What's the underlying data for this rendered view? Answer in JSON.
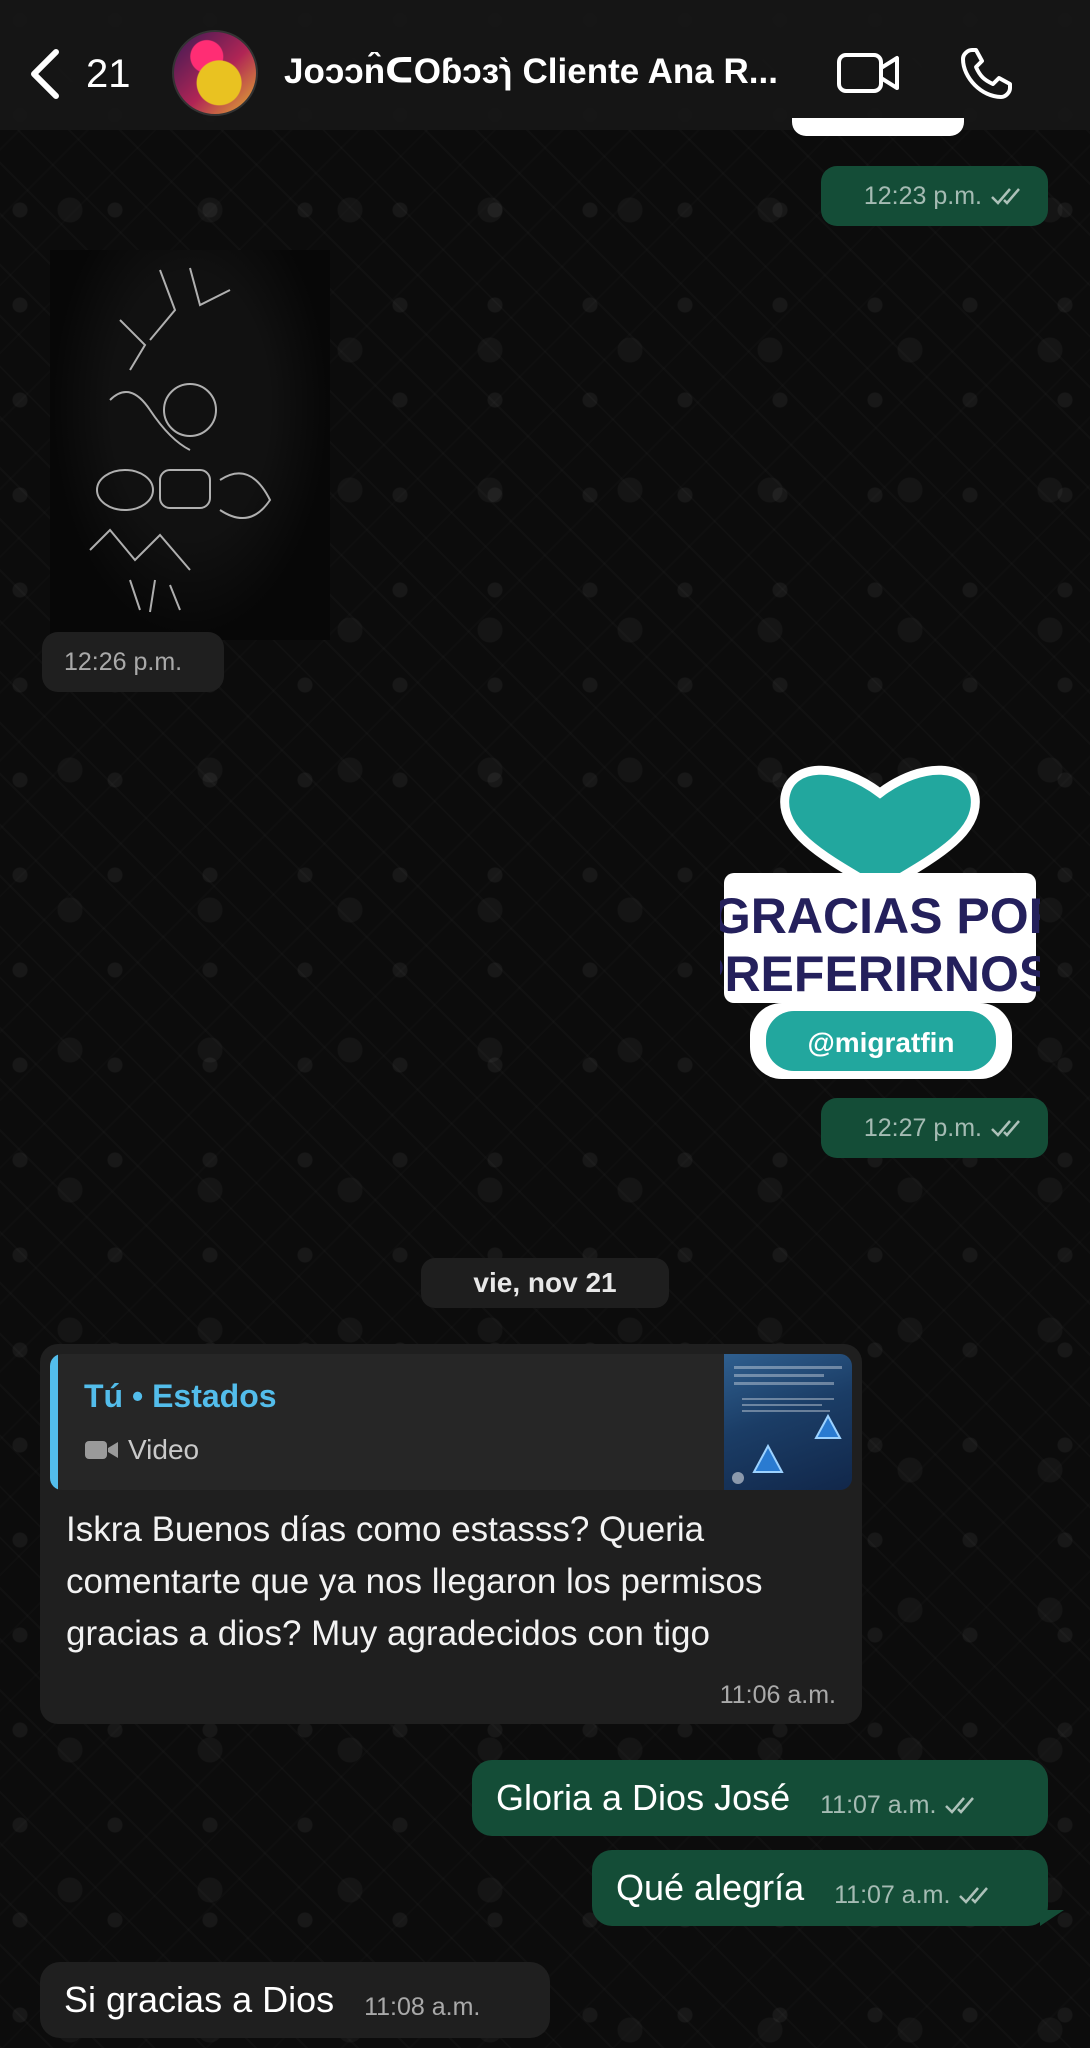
{
  "header": {
    "back_count": "21",
    "contact_name": "Joɔɔn̂ᑕOɓɔɜɿ̀ Cliente Ana R..."
  },
  "messages": {
    "m1_time": "12:23 p.m.",
    "m2_time": "12:26 p.m.",
    "sticker": {
      "line1": "¡GRACIAS POR",
      "line2": "PREFERIRNOS!",
      "handle": "@migratfin",
      "time": "12:27 p.m."
    },
    "date_separator": "vie, nov 21",
    "reply": {
      "quote_title": "Tú • Estados",
      "quote_type": "Video",
      "text": "Iskra Buenos días como estasss? Queria comentarte que ya nos llegaron los permisos gracias a dios? Muy agradecidos con tigo",
      "time": "11:06 a.m."
    },
    "m5": {
      "text": "Gloria a Dios José",
      "time": "11:07 a.m."
    },
    "m6": {
      "text": "Qué alegría",
      "time": "11:07 a.m."
    },
    "m7": {
      "text": "Si gracias a Dios",
      "time": "11:08 a.m."
    }
  },
  "colors": {
    "outgoing_bubble": "#144d37",
    "incoming_bubble": "#1f1f1f",
    "accent_blue": "#53bdeb",
    "sticker_teal": "#22a79e",
    "sticker_navy": "#24205c"
  }
}
